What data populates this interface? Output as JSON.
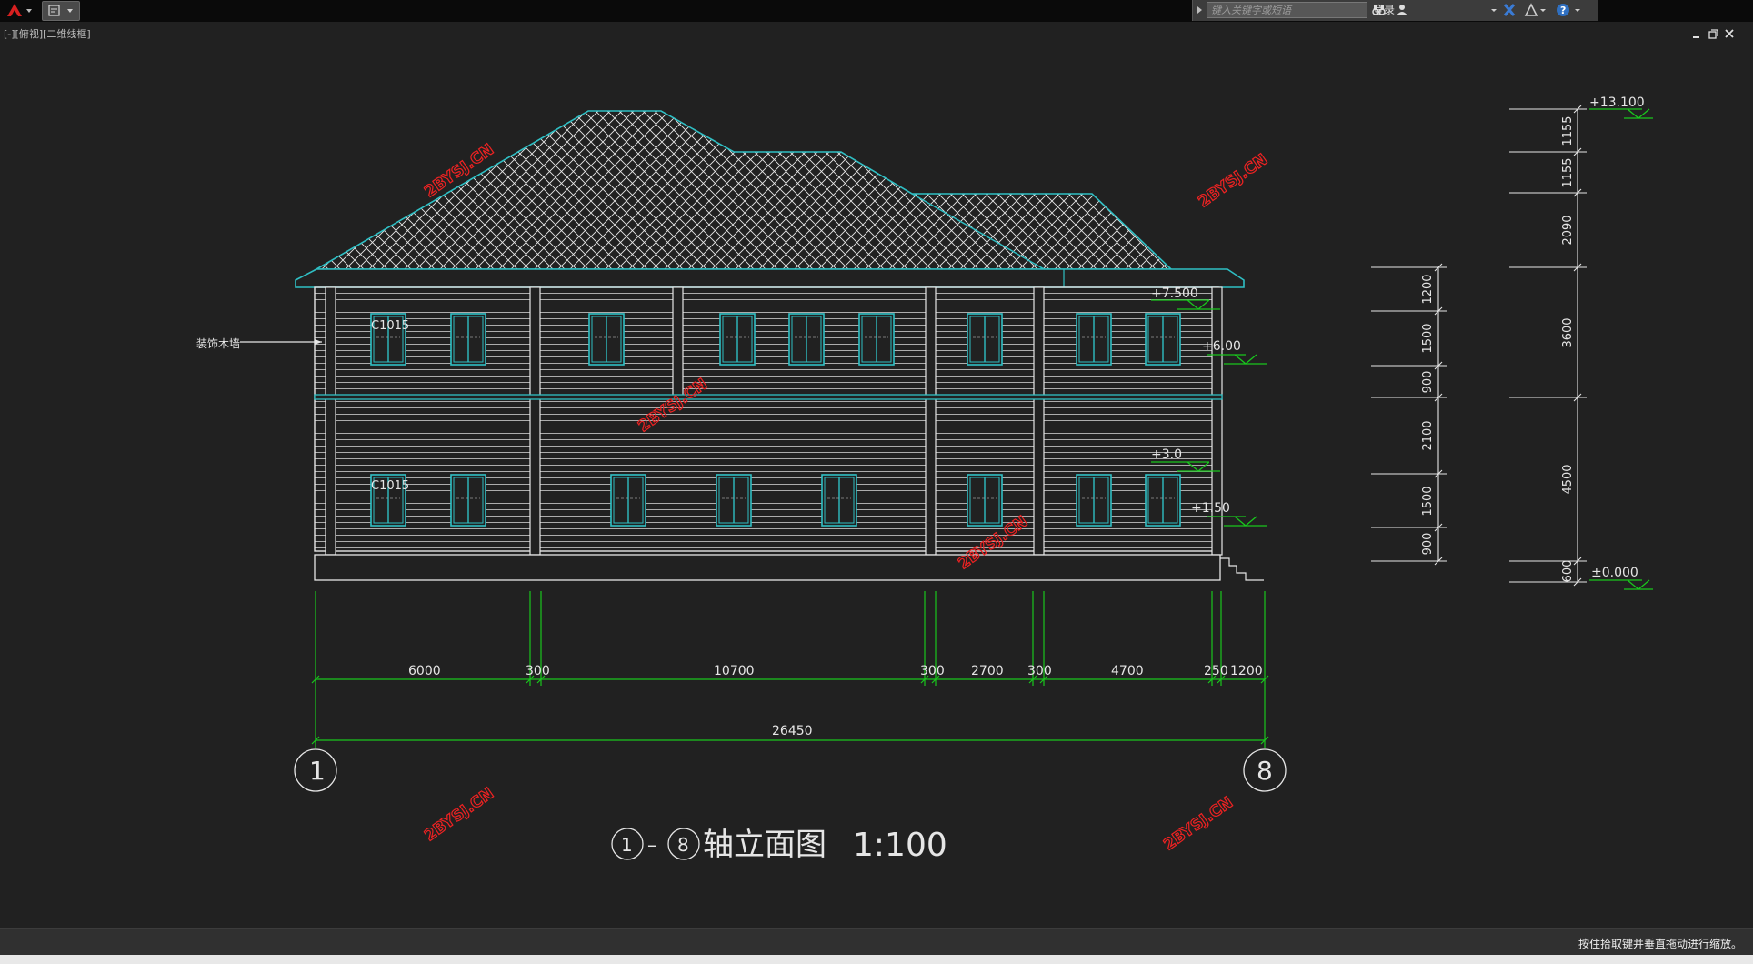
{
  "topbar": {
    "search_placeholder": "键入关键字或短语",
    "signin_label": "登录"
  },
  "viewport": {
    "label": "[-][俯视][二维线框]"
  },
  "drawing": {
    "title_circle_start": "1",
    "title_dash": "–",
    "title_circle_end": "8",
    "title_text": "轴立面图",
    "title_scale": "1:100",
    "wall_annotation": "装饰木墙",
    "window_tag_upper": "C1015",
    "window_tag_lower": "C1015",
    "axis_left": "1",
    "axis_right": "8",
    "levels": {
      "l7500": "+7.500",
      "l6": "+6.00",
      "l3": "+3.0",
      "l150": "+1.50",
      "l13100": "+13.100",
      "l0": "±0.000"
    },
    "dims_horizontal": [
      "6000",
      "300",
      "10700",
      "300",
      "2700",
      "300",
      "4700",
      "250",
      "1200"
    ],
    "dim_total": "26450",
    "dims_inner_vertical": [
      "1200",
      "1500",
      "900",
      "2100",
      "1500",
      "900"
    ],
    "dims_outer_vertical": [
      "1155",
      "1155",
      "2090",
      "3600",
      "4500",
      "600"
    ],
    "watermark": "2BYSJ.CN"
  },
  "statusbar": {
    "hint": "按住拾取键并垂直拖动进行缩放。"
  },
  "colors": {
    "cyan": "#2fbfc4",
    "green": "#19c61d",
    "white": "#e6e6e6",
    "watermark": "#ee2222",
    "background": "#212121"
  }
}
